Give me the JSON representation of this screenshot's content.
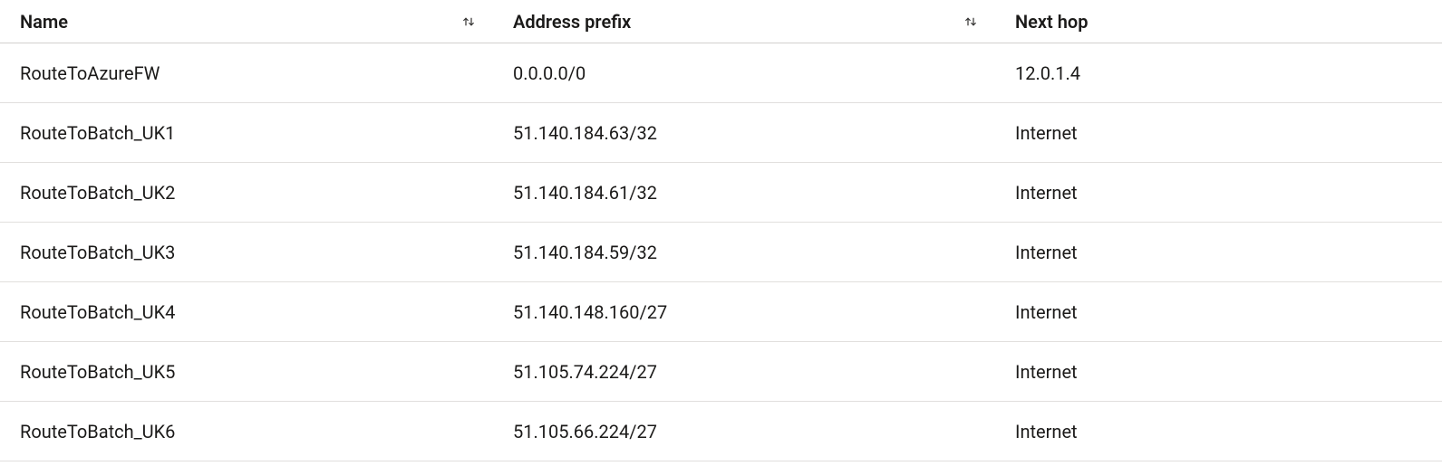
{
  "table": {
    "columns": {
      "name": {
        "label": "Name",
        "sortable": true
      },
      "prefix": {
        "label": "Address prefix",
        "sortable": true
      },
      "hop": {
        "label": "Next hop",
        "sortable": false
      }
    },
    "rows": [
      {
        "name": "RouteToAzureFW",
        "prefix": "0.0.0.0/0",
        "hop": "12.0.1.4"
      },
      {
        "name": "RouteToBatch_UK1",
        "prefix": "51.140.184.63/32",
        "hop": "Internet"
      },
      {
        "name": "RouteToBatch_UK2",
        "prefix": "51.140.184.61/32",
        "hop": "Internet"
      },
      {
        "name": "RouteToBatch_UK3",
        "prefix": "51.140.184.59/32",
        "hop": "Internet"
      },
      {
        "name": "RouteToBatch_UK4",
        "prefix": "51.140.148.160/27",
        "hop": "Internet"
      },
      {
        "name": "RouteToBatch_UK5",
        "prefix": "51.105.74.224/27",
        "hop": "Internet"
      },
      {
        "name": "RouteToBatch_UK6",
        "prefix": "51.105.66.224/27",
        "hop": "Internet"
      }
    ]
  }
}
